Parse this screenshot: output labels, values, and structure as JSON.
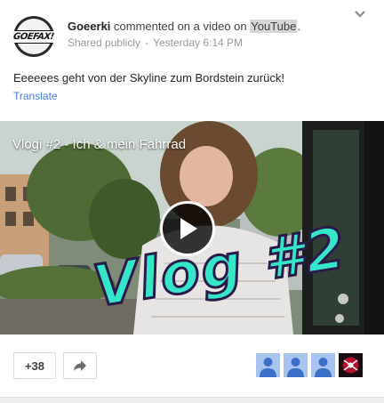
{
  "post": {
    "author": "Goeerki",
    "action_text": " commented on a video on ",
    "site": "YouTube",
    "suffix": ".",
    "visibility": "Shared publicly",
    "separator": "-",
    "timestamp": "Yesterday 6:14 PM",
    "avatar_text": "GOEFAX!"
  },
  "comment": {
    "text": "Eeeeees geht von der Skyline zum Bordstein zurück!",
    "translate": "Translate"
  },
  "video": {
    "title": "Vlogi #2 - Ich & mein Fahrrad",
    "overlay_text": "Vlog #2"
  },
  "actions": {
    "plus_count": "+38"
  },
  "plusers": [
    {
      "icon": "person-icon"
    },
    {
      "icon": "person-icon"
    },
    {
      "icon": "person-icon"
    },
    {
      "icon": "profile-image"
    }
  ],
  "colors": {
    "link": "#427fed",
    "overlay_text": "#35e6c8",
    "avatar_placeholder": "#a7c3ee"
  }
}
